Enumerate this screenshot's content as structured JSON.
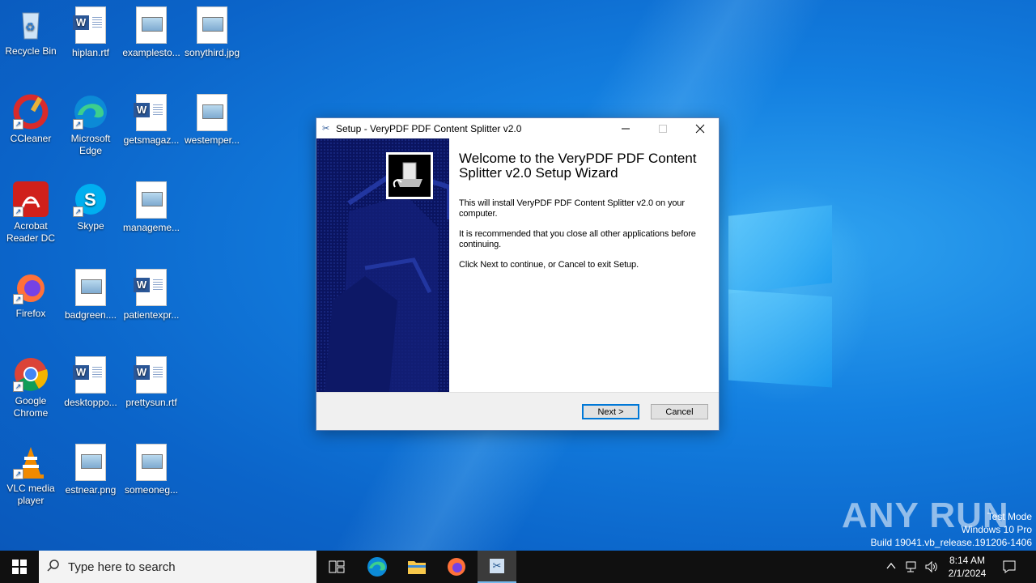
{
  "desktop": {
    "icons": [
      {
        "label": "Recycle Bin"
      },
      {
        "label": "hiplan.rtf"
      },
      {
        "label": "examplesto..."
      },
      {
        "label": "sonythird.jpg"
      },
      {
        "label": "CCleaner"
      },
      {
        "label": "Microsoft Edge"
      },
      {
        "label": "getsmagaz..."
      },
      {
        "label": "westemper..."
      },
      {
        "label": "Acrobat Reader DC"
      },
      {
        "label": "Skype"
      },
      {
        "label": "manageme..."
      },
      {
        "label": "Firefox"
      },
      {
        "label": "badgreen...."
      },
      {
        "label": "patientexpr..."
      },
      {
        "label": "Google Chrome"
      },
      {
        "label": "desktoppo..."
      },
      {
        "label": "prettysun.rtf"
      },
      {
        "label": "VLC media player"
      },
      {
        "label": "estnear.png"
      },
      {
        "label": "someoneg..."
      }
    ]
  },
  "dialog": {
    "title": "Setup - VeryPDF PDF Content Splitter v2.0",
    "heading": "Welcome to the VeryPDF PDF Content Splitter v2.0 Setup Wizard",
    "para1": "This will install VeryPDF PDF Content Splitter v2.0 on your computer.",
    "para2": "It is recommended that you close all other applications before continuing.",
    "para3": "Click Next to continue, or Cancel to exit Setup.",
    "next_label": "Next >",
    "cancel_label": "Cancel"
  },
  "taskbar": {
    "search_placeholder": "Type here to search",
    "time": "8:14 AM",
    "date": "2/1/2024"
  },
  "watermark": {
    "brand": "ANY RUN",
    "line1": "Test Mode",
    "line2": "Windows 10 Pro",
    "line3": "Build 19041.vb_release.191206-1406"
  },
  "colors": {
    "desktop_blue": "#0b64c9",
    "dialog_side": "#0a1460",
    "accent": "#0078d7"
  }
}
